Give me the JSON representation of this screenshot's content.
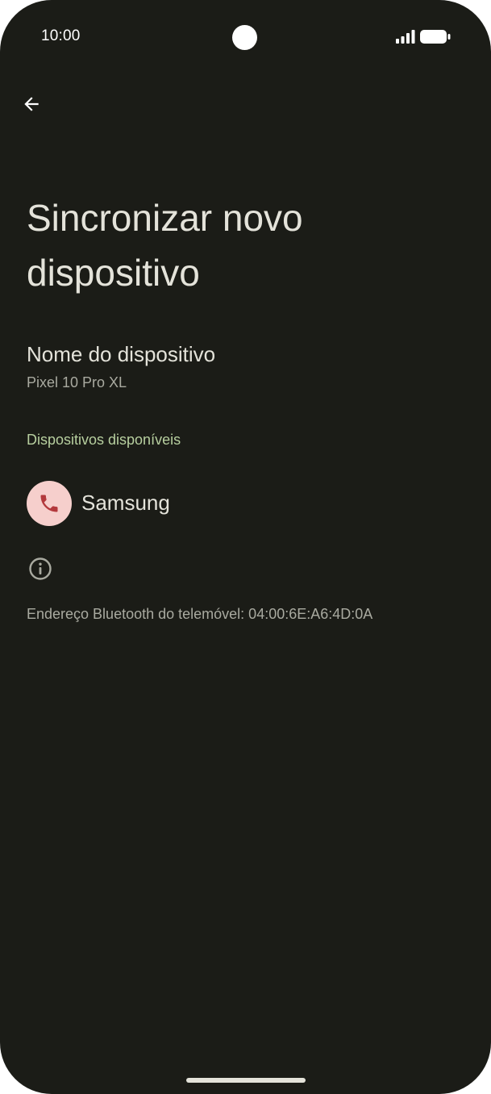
{
  "status_bar": {
    "time": "10:00",
    "signal_icon": "signal-bars-icon",
    "battery_icon": "battery-full-icon"
  },
  "header": {
    "back_icon": "arrow-back-icon",
    "title": "Sincronizar novo dispositivo"
  },
  "device_name": {
    "title": "Nome do dispositivo",
    "value": "Pixel 10 Pro XL"
  },
  "available_devices": {
    "header": "Dispositivos disponíveis",
    "items": [
      {
        "label": "Samsung",
        "icon": "phone-icon"
      }
    ]
  },
  "footer": {
    "info_icon": "info-icon",
    "bluetooth_address": "Endereço Bluetooth do telemóvel: 04:00:6E:A6:4D:0A"
  },
  "colors": {
    "background": "#1b1c17",
    "text_primary": "#e4e3da",
    "text_secondary": "#a9aaa0",
    "accent": "#b7cf9f",
    "avatar_bg": "#f6cfcc",
    "avatar_icon": "#b3393c"
  }
}
